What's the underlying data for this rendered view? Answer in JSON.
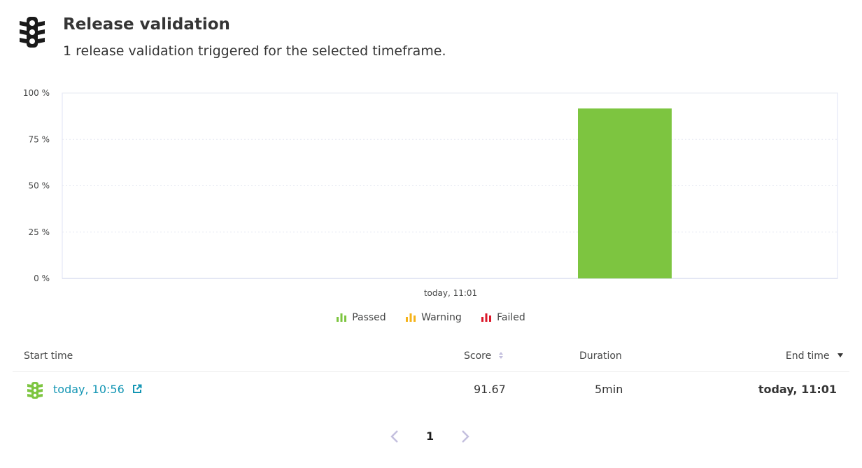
{
  "header": {
    "icon": "traffic-light-icon",
    "title": "Release validation",
    "subtitle": "1 release validation triggered for the selected timeframe."
  },
  "chart_data": {
    "type": "bar",
    "categories": [
      "today, 11:01"
    ],
    "series": [
      {
        "name": "Passed",
        "values": [
          91.67
        ],
        "color": "#7dc540"
      }
    ],
    "yticks": [
      "0 %",
      "25 %",
      "50 %",
      "75 %",
      "100 %"
    ],
    "ylim": [
      0,
      100
    ],
    "xlabel": "",
    "ylabel": "",
    "grid": true,
    "legend_position": "bottom"
  },
  "legend": {
    "items": [
      {
        "label": "Passed",
        "color": "#7dc540",
        "icon": "bar-chart-icon"
      },
      {
        "label": "Warning",
        "color": "#f5b31a",
        "icon": "bar-chart-icon"
      },
      {
        "label": "Failed",
        "color": "#dc172a",
        "icon": "bar-chart-icon"
      }
    ]
  },
  "table": {
    "headers": {
      "start_time": "Start time",
      "score": "Score",
      "duration": "Duration",
      "end_time": "End time"
    },
    "rows": [
      {
        "status_icon": "traffic-light-icon",
        "status_color": "#7dc540",
        "start_time": "today, 10:56",
        "score": "91.67",
        "duration": "5min",
        "end_time": "today, 11:01"
      }
    ]
  },
  "pagination": {
    "current_page": "1",
    "prev_icon": "chevron-left-icon",
    "next_icon": "chevron-right-icon"
  }
}
